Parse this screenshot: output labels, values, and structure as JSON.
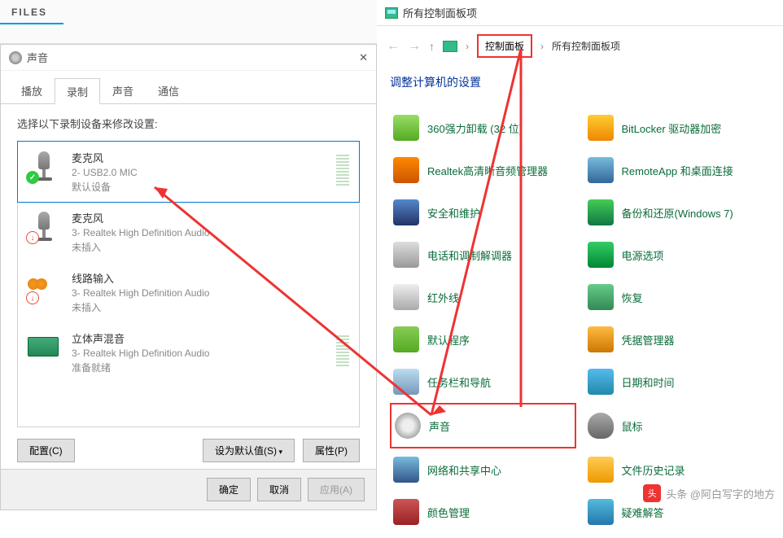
{
  "files_tab": "FILES",
  "sound": {
    "title": "声音",
    "tabs": {
      "play": "播放",
      "record": "录制",
      "sound": "声音",
      "comm": "通信"
    },
    "instruction": "选择以下录制设备来修改设置:",
    "devices": [
      {
        "name": "麦克风",
        "sub": "2- USB2.0 MIC",
        "status": "默认设备"
      },
      {
        "name": "麦克风",
        "sub": "3- Realtek High Definition Audio",
        "status": "未插入"
      },
      {
        "name": "线路输入",
        "sub": "3- Realtek High Definition Audio",
        "status": "未插入"
      },
      {
        "name": "立体声混音",
        "sub": "3- Realtek High Definition Audio",
        "status": "准备就绪"
      }
    ],
    "btn_config": "配置(C)",
    "btn_default": "设为默认值(S)",
    "btn_prop": "属性(P)",
    "btn_ok": "确定",
    "btn_cancel": "取消",
    "btn_apply": "应用(A)"
  },
  "cp": {
    "title": "所有控制面板项",
    "crumb1": "控制面板",
    "crumb2": "所有控制面板项",
    "heading": "调整计算机的设置",
    "items": [
      "360强力卸载 (32 位)",
      "BitLocker 驱动器加密",
      "Realtek高清晰音频管理器",
      "RemoteApp 和桌面连接",
      "安全和维护",
      "备份和还原(Windows 7)",
      "电话和调制解调器",
      "电源选项",
      "红外线",
      "恢复",
      "默认程序",
      "凭据管理器",
      "任务栏和导航",
      "日期和时间",
      "声音",
      "鼠标",
      "网络和共享中心",
      "文件历史记录",
      "颜色管理",
      "疑难解答"
    ]
  },
  "watermark": "头条 @阿白写字的地方"
}
